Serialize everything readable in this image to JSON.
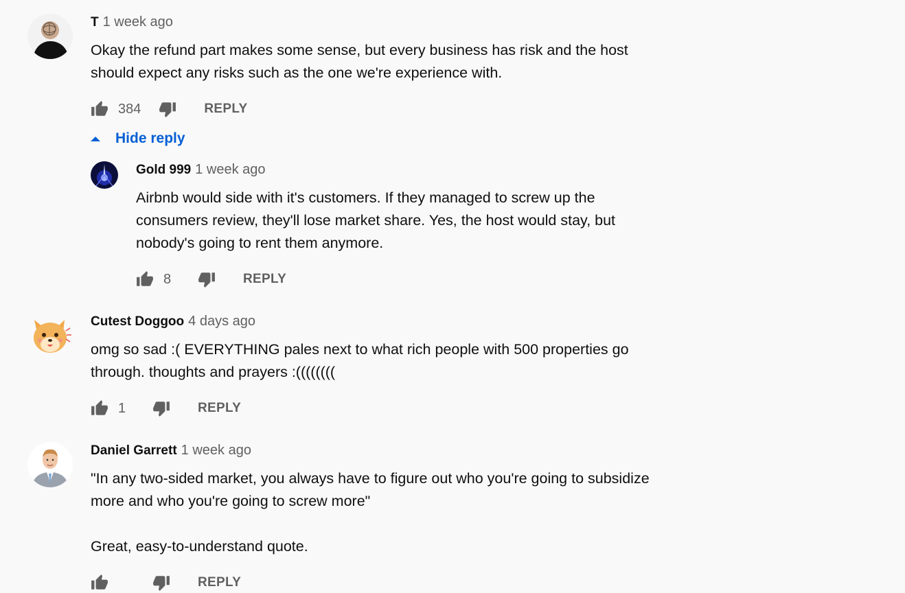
{
  "comments": [
    {
      "author": "T",
      "time": "1 week ago",
      "text": "Okay the refund part makes some sense, but every business has risk and the host\nshould expect any risks such as the one we're experience with.",
      "likes": "384",
      "reply_label": "REPLY",
      "hide_replies_label": "Hide reply",
      "replies": [
        {
          "author": "Gold 999",
          "time": "1 week ago",
          "text": "Airbnb would side with it's customers. If they managed to screw up the\nconsumers review, they'll lose market share. Yes, the host would stay, but\nnobody's going to rent them anymore.",
          "likes": "8",
          "reply_label": "REPLY"
        }
      ]
    },
    {
      "author": "Cutest Doggoo",
      "time": "4 days ago",
      "text": "omg so sad :( EVERYTHING pales next to what rich people with 500 properties go\nthrough. thoughts and prayers :((((((((",
      "likes": "1",
      "reply_label": "REPLY"
    },
    {
      "author": "Daniel Garrett",
      "time": "1 week ago",
      "text": "\"In any two-sided market, you always have to figure out who you're going to subsidize\nmore and who you're going to screw more\"\n\nGreat, easy-to-understand quote.",
      "likes": "",
      "reply_label": "REPLY"
    }
  ],
  "icons": {
    "like": "thumb-up-icon",
    "dislike": "thumb-down-icon",
    "collapse": "caret-up-icon"
  },
  "colors": {
    "link_blue": "#065fd4",
    "secondary_text": "#606060",
    "background": "#f9f9f9"
  }
}
